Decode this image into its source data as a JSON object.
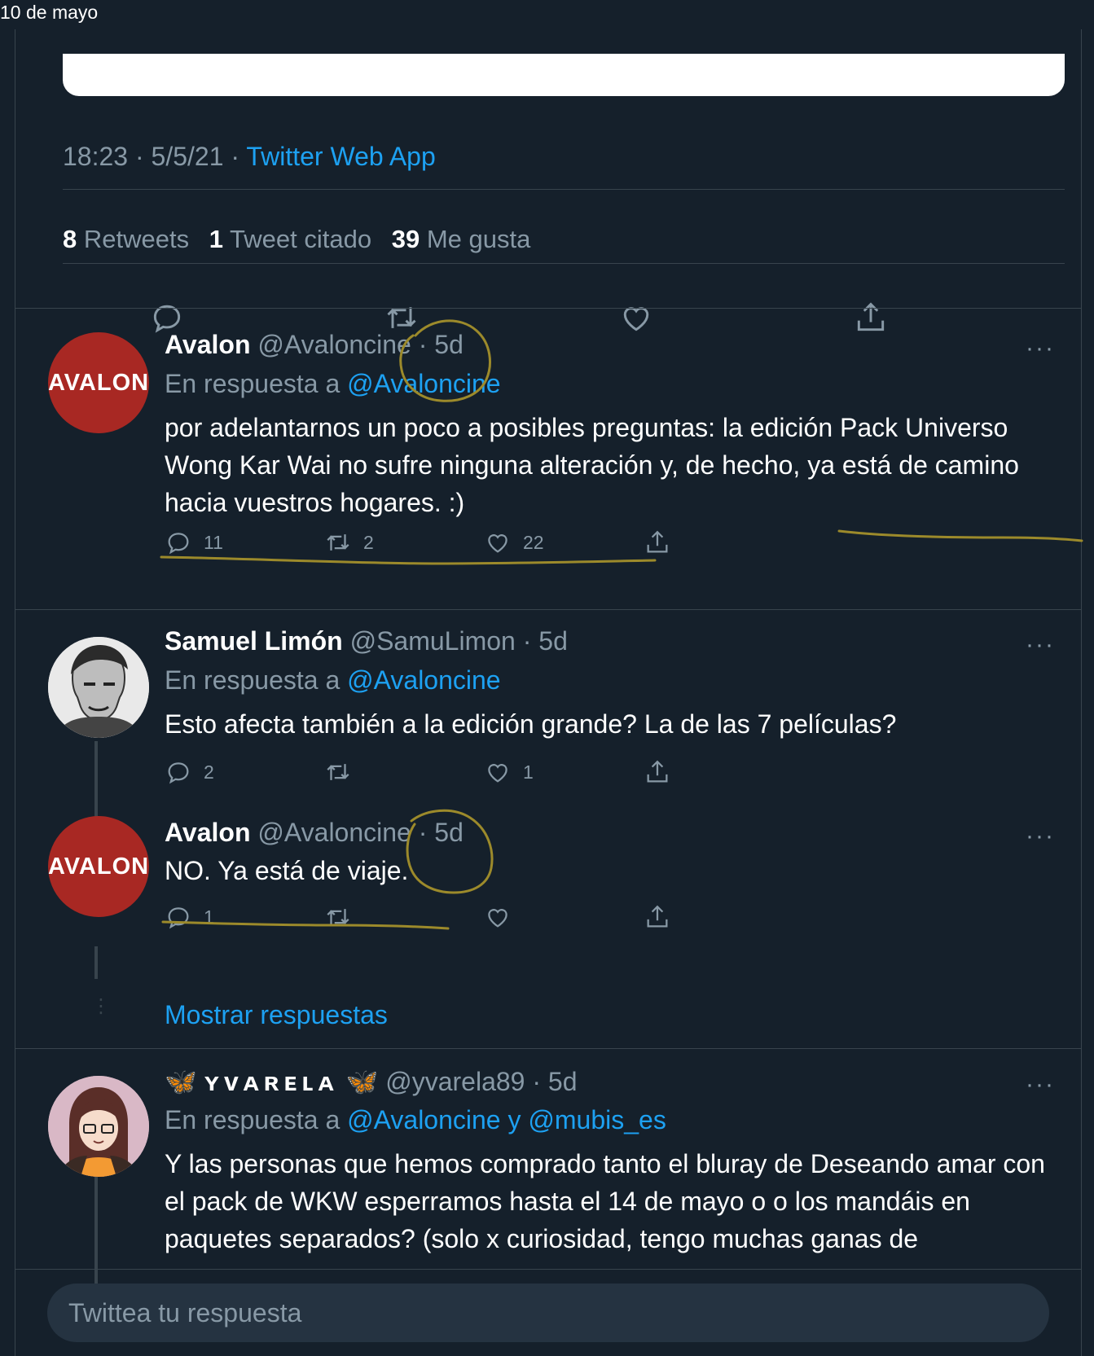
{
  "date_header": "10 de mayo",
  "main_tweet": {
    "time": "18:23",
    "date": "5/5/21",
    "source": "Twitter Web App",
    "stats": [
      {
        "count": "8",
        "label": "Retweets"
      },
      {
        "count": "1",
        "label": "Tweet citado"
      },
      {
        "count": "39",
        "label": "Me gusta"
      }
    ]
  },
  "separator": "·",
  "replies": [
    {
      "name": "Avalon",
      "handle": "@Avaloncine",
      "age": "5d",
      "avatar_text": "AVALON",
      "reply_prefix": "En respuesta a",
      "reply_to": "@Avaloncine",
      "text": "por adelantarnos un poco a posibles preguntas: la edición Pack Universo Wong Kar Wai no sufre ninguna alteración y, de hecho, ya está de camino hacia vuestros hogares. :)",
      "reply_count": "11",
      "retweet_count": "2",
      "like_count": "22"
    },
    {
      "name": "Samuel Limón",
      "handle": "@SamuLimon",
      "age": "5d",
      "reply_prefix": "En respuesta a",
      "reply_to": "@Avaloncine",
      "text": "Esto afecta también a la edición grande? La de las 7 películas?",
      "reply_count": "2",
      "retweet_count": "",
      "like_count": "1"
    },
    {
      "name": "Avalon",
      "handle": "@Avaloncine",
      "age": "5d",
      "avatar_text": "AVALON",
      "text": "NO. Ya está de viaje.",
      "reply_count": "1",
      "retweet_count": "",
      "like_count": ""
    },
    {
      "name": "ʏᴠᴀʀᴇʟᴀ",
      "handle": "@yvarela89",
      "age": "5d",
      "reply_prefix": "En respuesta a",
      "reply_to": "@Avaloncine y @mubis_es",
      "text": "Y las personas que hemos comprado tanto el bluray de Deseando amar con el pack de WKW esperramos hasta el 14 de mayo o o los mandáis en paquetes separados? (solo x curiosidad, tengo muchas ganas de"
    }
  ],
  "show_replies": "Mostrar respuestas",
  "compose": {
    "placeholder": "Twittea tu respuesta"
  },
  "colors": {
    "background": "#15202b",
    "accent": "#1da1f2",
    "muted": "#8899a6",
    "border": "#38444d",
    "annotation": "#9c8a2b"
  }
}
